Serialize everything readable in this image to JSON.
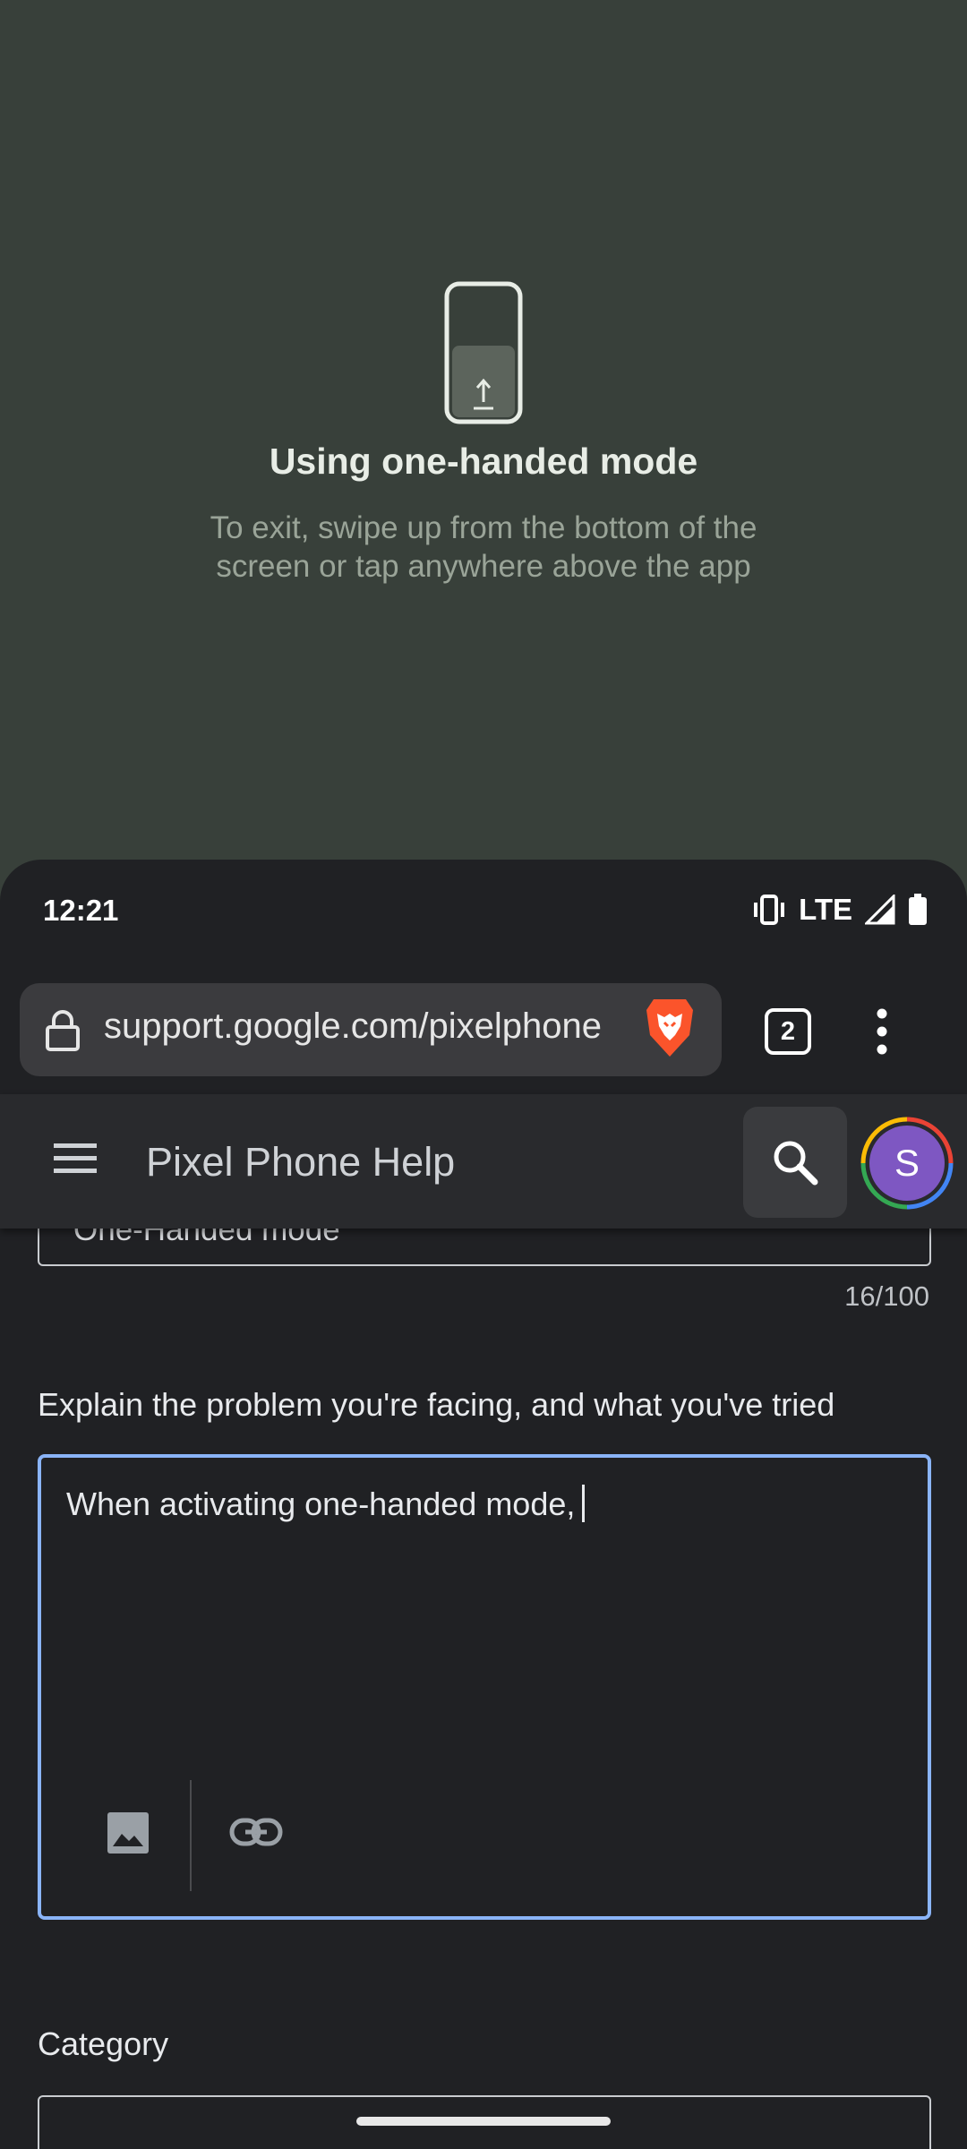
{
  "overlay": {
    "title": "Using one-handed mode",
    "subtitle": "To exit, swipe up from the bottom of the screen or tap anywhere above the app",
    "icon": "phone-swipe-up-icon"
  },
  "status_bar": {
    "time": "12:21",
    "network": "LTE",
    "icons": [
      "vibrate-icon",
      "signal-icon",
      "battery-icon"
    ]
  },
  "browser": {
    "url": "support.google.com/pixelphone",
    "tab_count": "2",
    "icons": [
      "lock-icon",
      "brave-lion-icon",
      "more-vert-icon"
    ]
  },
  "site_header": {
    "title": "Pixel Phone Help",
    "avatar_initial": "S",
    "icons": [
      "menu-icon",
      "search-icon"
    ]
  },
  "form": {
    "subject_value": "One-Handed mode",
    "subject_counter": "16/100",
    "explain_label": "Explain the problem you're facing, and what you've tried",
    "explain_value": "When activating one-handed mode,",
    "category_label": "Category",
    "toolbar_icons": [
      "image-icon",
      "link-icon"
    ]
  },
  "colors": {
    "overlay_bg": "#38403a",
    "app_bg": "#202124",
    "accent_focus": "#8ab4f8",
    "avatar": "#7e57c2"
  }
}
